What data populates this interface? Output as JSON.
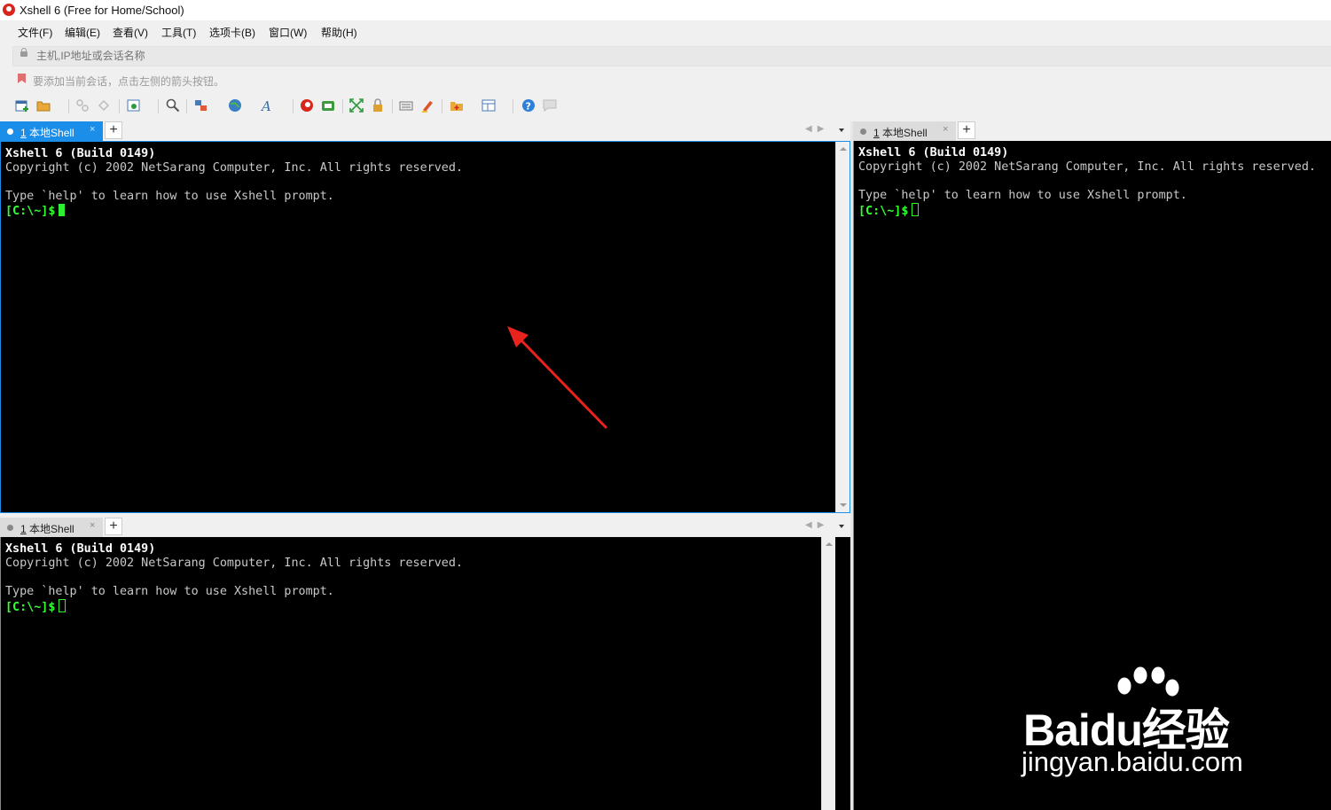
{
  "window": {
    "title": "Xshell 6 (Free for Home/School)"
  },
  "menu": {
    "items": [
      "文件(F)",
      "编辑(E)",
      "查看(V)",
      "工具(T)",
      "选项卡(B)",
      "窗口(W)",
      "帮助(H)"
    ]
  },
  "address": {
    "placeholder": "主机,IP地址或会话名称",
    "value": ""
  },
  "hint_bar": {
    "text": "要添加当前会话，点击左侧的箭头按钮。"
  },
  "toolbar": {
    "icons": [
      "new-session-icon",
      "open-folder-icon",
      "connect-icon",
      "disconnect-icon",
      "properties-icon",
      "find-icon",
      "transfer-icon",
      "globe-icon",
      "font-icon",
      "xshell-icon",
      "xftp-icon",
      "fullscreen-icon",
      "lock-icon",
      "keyboard-icon",
      "highlight-icon",
      "new-tab-icon",
      "layout-icon",
      "help-icon",
      "chat-icon"
    ]
  },
  "panes": {
    "top_left": {
      "tab": {
        "number": "1",
        "label": "本地Shell",
        "active": true
      }
    },
    "bottom_left": {
      "tab": {
        "number": "1",
        "label": "本地Shell",
        "active": false
      }
    },
    "right": {
      "tab": {
        "number": "1",
        "label": "本地Shell",
        "active": false
      }
    }
  },
  "terminal": {
    "banner": "Xshell 6 (Build 0149)",
    "copyright": "Copyright (c) 2002 NetSarang Computer, Inc. All rights reserved.",
    "help_line": "Type `help' to learn how to use Xshell prompt.",
    "prompt": "[C:\\~]$"
  },
  "watermark": {
    "brand": "Bai",
    "brand_suffix": "du经验",
    "url": "jingyan.baidu.com"
  },
  "colors": {
    "tab_active": "#1b8ee9",
    "prompt_green": "#33ff33",
    "annotation_arrow": "#e8231d"
  }
}
